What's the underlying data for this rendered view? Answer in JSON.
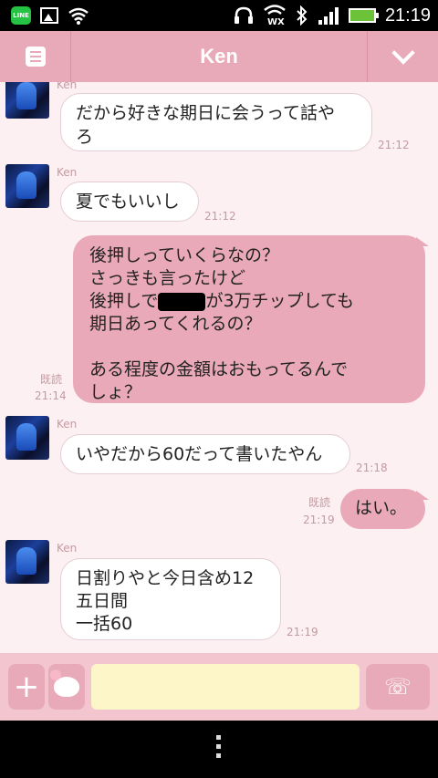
{
  "status_bar": {
    "time": "21:19",
    "wifi_label": "WX",
    "line_label": "LINE"
  },
  "header": {
    "title": "Ken"
  },
  "messages": [
    {
      "sender": "Ken",
      "text": "だから好きな期日に会うって話や\nろ",
      "time": "21:12"
    },
    {
      "sender": "Ken",
      "text": "夏でもいいし",
      "time": "21:12"
    },
    {
      "text_before": "後押しっていくらなの？\nさっきも言ったけど\n後押しで",
      "text_after": "が3万チップしても\n期日あってくれるの？\n\nある程度の金額はおもってるんで\nしょ？",
      "read": "既読",
      "time": "21:14"
    },
    {
      "sender": "Ken",
      "text": "いやだから60だって書いたやん",
      "time": "21:18"
    },
    {
      "text": "はい。",
      "read": "既読",
      "time": "21:19"
    },
    {
      "sender": "Ken",
      "text": "日割りやと今日含め12\n五日間\n一括60",
      "time": "21:19"
    }
  ],
  "input_bar": {
    "plus_label": "+",
    "call_icon": "☏",
    "placeholder": ""
  },
  "colors": {
    "header": "#e8a9b8",
    "outgoing_bubble": "#eaa9b8",
    "input_field": "#fdf6c9",
    "background": "#fdf0f2"
  }
}
